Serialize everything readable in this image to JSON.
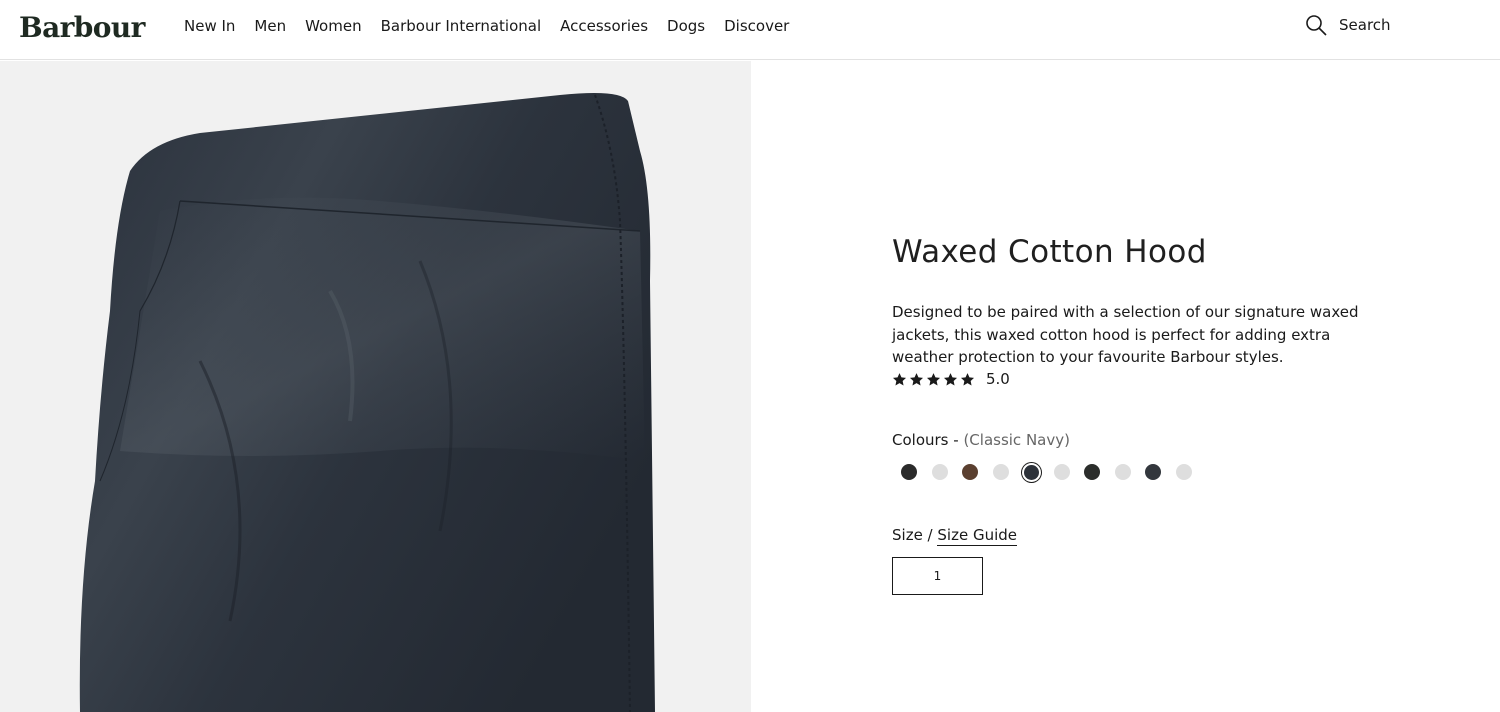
{
  "brand": {
    "name": "Barbour"
  },
  "nav": {
    "items": [
      {
        "label": "New In"
      },
      {
        "label": "Men"
      },
      {
        "label": "Women"
      },
      {
        "label": "Barbour International"
      },
      {
        "label": "Accessories"
      },
      {
        "label": "Dogs"
      },
      {
        "label": "Discover"
      }
    ]
  },
  "search": {
    "label": "Search",
    "icon": "search-icon"
  },
  "product": {
    "title": "Waxed Cotton Hood",
    "description": "Designed to be paired with a selection of our signature waxed jackets, this waxed cotton hood is perfect for adding extra weather protection to your favourite Barbour styles.",
    "rating": {
      "value": "5.0",
      "stars": 5,
      "max": 5
    },
    "colours": {
      "label": "Colours -",
      "selected": "(Classic Navy)",
      "swatches": [
        {
          "color": "#2b2b2b",
          "active": false
        },
        {
          "color": "#dedede",
          "active": false
        },
        {
          "color": "#5b4030",
          "active": false
        },
        {
          "color": "#dedede",
          "active": false
        },
        {
          "color": "#2c3139",
          "active": true
        },
        {
          "color": "#dedede",
          "active": false
        },
        {
          "color": "#2b2d2b",
          "active": false
        },
        {
          "color": "#dedede",
          "active": false
        },
        {
          "color": "#33373d",
          "active": false
        },
        {
          "color": "#dedede",
          "active": false
        }
      ]
    },
    "size": {
      "label": "Size /",
      "guide_label": "Size Guide",
      "selected": "1"
    }
  },
  "colors": {
    "accent": "#1a1a1a",
    "image_bg": "#f1f1f1",
    "hood": "#2b323d"
  }
}
